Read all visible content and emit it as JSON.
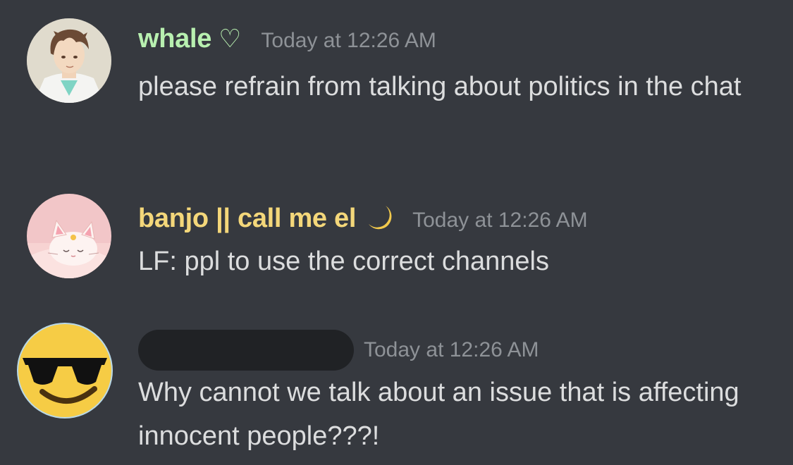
{
  "messages": [
    {
      "username": "whale",
      "username_color": "#b8f0b0",
      "badge": "♡",
      "timestamp": "Today at 12:26 AM",
      "content": "please refrain from talking about politics in the chat",
      "avatar": "anime-character-avatar"
    },
    {
      "username": "banjo || call me el",
      "username_color": "#f4d77a",
      "badge": "🌙",
      "timestamp": "Today at 12:26 AM",
      "content": "LF: ppl to use the correct channels",
      "avatar": "pink-cat-avatar"
    },
    {
      "username": "",
      "username_redacted": true,
      "timestamp": "Today at 12:26 AM",
      "content": "Why cannot we talk about an issue that is affecting innocent people???!",
      "avatar": "sunglasses-emoji-avatar"
    }
  ]
}
